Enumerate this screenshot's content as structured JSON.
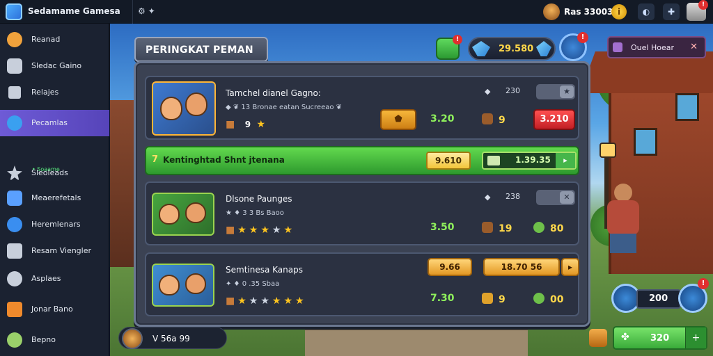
{
  "topbar": {
    "app_title": "Sedamame Gamesa",
    "icons_text": "⚙ ✦",
    "user_name": "Ras 33003",
    "coin_glyph": "i",
    "profile_badge": "!"
  },
  "sidebar": {
    "items": [
      {
        "label": "Reanad",
        "icon": "avatar-icon",
        "color": "#f0a23c"
      },
      {
        "label": "Sledac Gaino",
        "icon": "controller-icon",
        "color": "#c8cfdb"
      },
      {
        "label": "Relajes",
        "icon": "grid-icon",
        "color": "#c8cfdb"
      },
      {
        "label": "Pecamlas",
        "icon": "globe-icon",
        "color": "#3aa0f0"
      },
      {
        "label": "Sleoleads",
        "icon": "star-icon",
        "color": "#c8cfdb"
      },
      {
        "label": "Meaerefetals",
        "icon": "apps-icon",
        "color": "#5aa0ff"
      },
      {
        "label": "Heremlenars",
        "icon": "info-icon",
        "color": "#3a8ef0"
      },
      {
        "label": "Resam Viengler",
        "icon": "chat-icon",
        "color": "#c8cfdb"
      },
      {
        "label": "Asplaes",
        "icon": "gear-icon",
        "color": "#c8cfdb"
      },
      {
        "label": "Jonar Bano",
        "icon": "folder-icon",
        "color": "#f08a2c"
      },
      {
        "label": "Bepno",
        "icon": "user-icon",
        "color": "#9ad06a"
      }
    ],
    "active_sub": "• Soaame"
  },
  "hud": {
    "title": "PERINGKAT PEMAN",
    "gift_badge": "!",
    "gems": "29.580",
    "shield_badge": "!",
    "notice": "Ouel Hoear"
  },
  "cards": [
    {
      "name": "Tamchel dianel Gagno:",
      "meta": "◆ ❦ 13 Bronae eatan Sucreeao ❦",
      "level": "9",
      "stars": [
        "on"
      ],
      "stat_icon": "◆",
      "stat_value": "230",
      "green_value": "3.20",
      "cost": "9",
      "action": "3.210"
    },
    {
      "name": "Dlsone Paunges",
      "meta": "★ ♦ 3 3 Bs Baoo",
      "stars": [
        "on",
        "on",
        "on",
        "on",
        "off",
        "on"
      ],
      "stat_icon": "◆",
      "stat_value": "238",
      "green_value": "3.50",
      "cost": "19",
      "reward": "80"
    },
    {
      "name": "Semtinesa Kanaps",
      "meta": "✦ ♦ 0 .35 Sbaa",
      "stars": [
        "on",
        "off",
        "off",
        "on",
        "on",
        "on"
      ],
      "green_value": "7.30",
      "cost": "9",
      "reward": "00",
      "pill1": "9.66",
      "pill2": "18.70 56"
    }
  ],
  "highlight": {
    "rank": "7",
    "label": "Kentinghtad Shnt jtenana",
    "pill1": "9.610",
    "pill2": "1.39.35"
  },
  "bottom": {
    "player": "V  56a 99",
    "counter": "200",
    "counter_badge": "!",
    "green_value": "320",
    "plus": "+"
  }
}
